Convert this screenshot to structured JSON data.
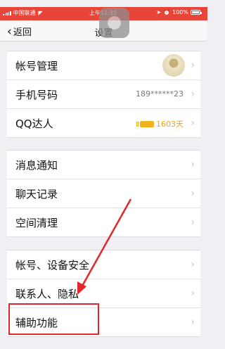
{
  "statusbar": {
    "carrier": "中国联通",
    "time": "上午11:35",
    "battery": "100%"
  },
  "navbar": {
    "back_label": "返回",
    "title": "设置"
  },
  "groups": [
    {
      "rows": [
        {
          "label": "帐号管理",
          "value": "",
          "has_avatar": true
        },
        {
          "label": "手机号码",
          "value": "189******23"
        },
        {
          "label": "QQ达人",
          "value": "1603天",
          "badge": "QQ达人"
        }
      ]
    },
    {
      "rows": [
        {
          "label": "消息通知"
        },
        {
          "label": "聊天记录"
        },
        {
          "label": "空间清理"
        }
      ]
    },
    {
      "rows": [
        {
          "label": "帐号、设备安全"
        },
        {
          "label": "联系人、隐私"
        },
        {
          "label": "辅助功能"
        }
      ]
    }
  ],
  "colors": {
    "statusbar": "#e8453a",
    "annotation": "#e3262c",
    "qq_badge": "#f2a21b"
  }
}
